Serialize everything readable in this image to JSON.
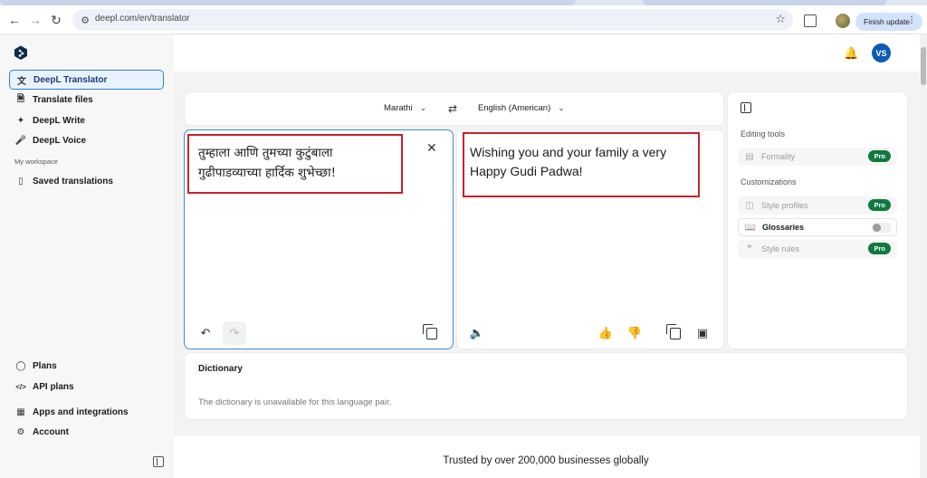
{
  "browser": {
    "url": "deepl.com/en/translator",
    "finish_update_label": "Finish update"
  },
  "sidebar": {
    "items": [
      {
        "label": "DeepL Translator",
        "icon": "translate-icon"
      },
      {
        "label": "Translate files",
        "icon": "file-icon"
      },
      {
        "label": "DeepL Write",
        "icon": "magic-pen-icon"
      },
      {
        "label": "DeepL Voice",
        "icon": "microphone-icon"
      }
    ],
    "section_label": "My workspace",
    "workspace_items": [
      {
        "label": "Saved translations",
        "icon": "bookmark-icon"
      }
    ],
    "bottom_items": [
      {
        "label": "Plans",
        "icon": "tag-icon"
      },
      {
        "label": "API plans",
        "icon": "code-icon"
      },
      {
        "label": "Apps and integrations",
        "icon": "apps-icon"
      },
      {
        "label": "Account",
        "icon": "gear-icon"
      }
    ]
  },
  "header": {
    "avatar_initials": "VS"
  },
  "translator": {
    "source_language": "Marathi",
    "target_language": "English (American)",
    "source_text_line1": "तुम्हाला आणि तुमच्या कुटुंबाला",
    "source_text_line2": "गुढीपाडव्याच्या हार्दिक शुभेच्छा!",
    "target_text_line1": "Wishing you and your family a very",
    "target_text_line2": "Happy Gudi Padwa!"
  },
  "tools": {
    "editing_label": "Editing tools",
    "formality_label": "Formality",
    "customizations_label": "Customizations",
    "style_profiles_label": "Style profiles",
    "glossaries_label": "Glossaries",
    "style_rules_label": "Style rules",
    "pro_badge": "Pro"
  },
  "dictionary": {
    "title": "Dictionary",
    "message": "The dictionary is unavailable for this language pair."
  },
  "footer": {
    "trusted": "Trusted by over 200,000 businesses globally"
  },
  "colors": {
    "accent": "#0d5bb5",
    "highlight_border": "#c8222c",
    "pro_badge": "#0f7a3f"
  }
}
